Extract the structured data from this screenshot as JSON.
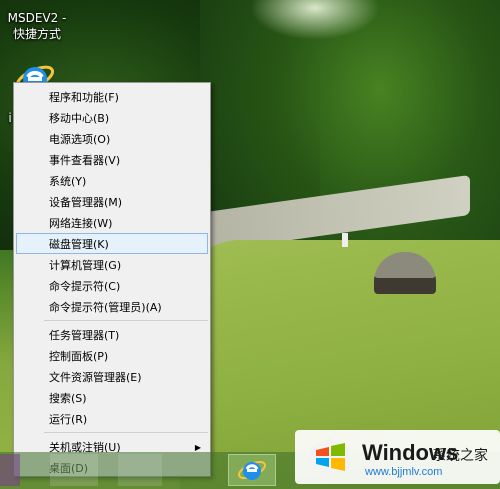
{
  "desktop": {
    "shortcut_label_line1": "MSDEV2 -",
    "shortcut_label_line2": "快捷方式",
    "ie_partial_label": "i"
  },
  "context_menu": {
    "groups": [
      [
        {
          "label": "程序和功能(F)"
        },
        {
          "label": "移动中心(B)"
        },
        {
          "label": "电源选项(O)"
        },
        {
          "label": "事件查看器(V)"
        },
        {
          "label": "系统(Y)"
        },
        {
          "label": "设备管理器(M)"
        },
        {
          "label": "网络连接(W)"
        },
        {
          "label": "磁盘管理(K)",
          "highlighted": true
        },
        {
          "label": "计算机管理(G)"
        },
        {
          "label": "命令提示符(C)"
        },
        {
          "label": "命令提示符(管理员)(A)"
        }
      ],
      [
        {
          "label": "任务管理器(T)"
        },
        {
          "label": "控制面板(P)"
        },
        {
          "label": "文件资源管理器(E)"
        },
        {
          "label": "搜索(S)"
        },
        {
          "label": "运行(R)"
        }
      ],
      [
        {
          "label": "关机或注销(U)",
          "submenu": true
        },
        {
          "label": "桌面(D)"
        }
      ]
    ],
    "submenu_arrow": "▶"
  },
  "watermark": {
    "title": "Windows",
    "subtitle": "系统之家",
    "url": "www.bjjmlv.com"
  },
  "colors": {
    "menu_highlight_bg": "#e5f1fb",
    "menu_highlight_border": "#8fb7e4",
    "windows_red": "#f25022",
    "windows_green": "#7fba00",
    "windows_blue": "#00a4ef",
    "windows_yellow": "#ffb900"
  }
}
